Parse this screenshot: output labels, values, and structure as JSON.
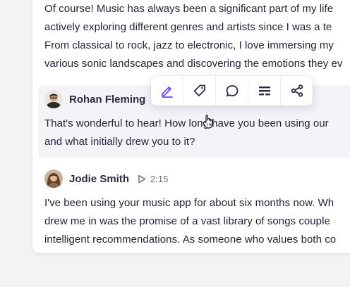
{
  "messages": [
    {
      "lines": [
        "Of course! Music has always been a significant part of my life",
        "actively exploring different genres and artists since I was a te",
        "From classical to rock, jazz to electronic, I love immersing my",
        "various sonic landscapes and discovering the emotions they ev"
      ]
    },
    {
      "speaker": "Rohan Fleming",
      "lines": [
        "That's wonderful to hear! How long have you been using our",
        "and what initially drew you to it?"
      ]
    },
    {
      "speaker": "Jodie Smith",
      "duration": "2:15",
      "lines": [
        "I've been using your music app for about six months now. Wh",
        "drew me in was the promise of a vast library of songs couple",
        "intelligent recommendations. As someone who values both co"
      ]
    }
  ],
  "toolbar": {
    "tools": [
      "edit-icon",
      "tag-icon",
      "comment-icon",
      "format-icon",
      "share-icon"
    ],
    "accent_color": "#6b4ce6"
  }
}
